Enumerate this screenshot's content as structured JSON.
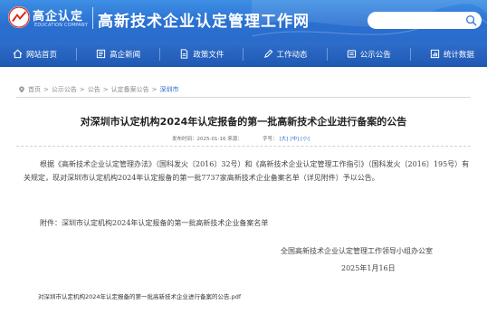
{
  "logo": {
    "cn": "高企认定",
    "en": "EDUCATION COMPANY"
  },
  "site_title": "高新技术企业认定管理工作网",
  "search": {
    "value": "",
    "placeholder": ""
  },
  "nav": [
    {
      "label": "网站首页",
      "icon": "home-icon"
    },
    {
      "label": "高企新闻",
      "icon": "news-icon"
    },
    {
      "label": "政策文件",
      "icon": "document-icon"
    },
    {
      "label": "工作动态",
      "icon": "pen-icon"
    },
    {
      "label": "公示公告",
      "icon": "notice-icon"
    },
    {
      "label": "统计数据",
      "icon": "stats-icon"
    }
  ],
  "breadcrumb": {
    "items": [
      "首页",
      "公示公告",
      "公告",
      "认定备案公告",
      "深圳市"
    ],
    "separator": ">"
  },
  "article": {
    "title": "对深圳市认定机构2024年认定报备的第一批高新技术企业进行备案的公告",
    "meta_date": "发布时间：2025-01-16 来源：",
    "meta_font_label": "字号：",
    "font_sizes": [
      "[大]",
      "[中]",
      "[小]"
    ],
    "para1": "根据《高新技术企业认定管理办法》（国科发火〔2016〕32号）和《高新技术企业认定管理工作指引》（国科发火〔2016〕195号）有关规定，现对深圳市认定机构2024年认定报备的第一批7737家高新技术企业备案名单（详见附件）予以公告。",
    "para2": "附件：深圳市认定机构2024年认定报备的第一批高新技术企业备案名单",
    "sign_org": "全国高新技术企业认定管理工作领导小组办公室",
    "sign_date": "2025年1月16日",
    "attachment": "对深圳市认定机构2024年认定报备的第一批高新技术企业进行备案的公告.pdf"
  },
  "colors": {
    "header_blue": "#2a6ccb",
    "nav_blue": "#1f58b3",
    "logo_red": "#d8281f",
    "link_blue": "#2a6ccb"
  }
}
